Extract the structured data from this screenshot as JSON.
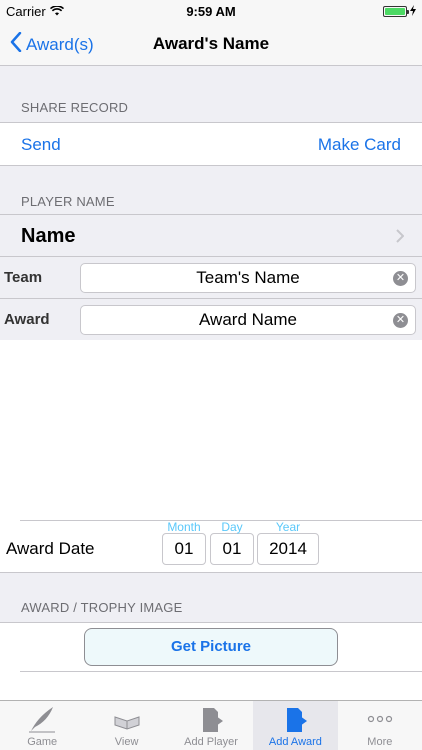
{
  "status": {
    "carrier": "Carrier",
    "time": "9:59 AM",
    "battery_percent": 100
  },
  "nav": {
    "back_label": "Award(s)",
    "title": "Award's Name"
  },
  "share": {
    "header": "SHARE RECORD",
    "send": "Send",
    "make_card": "Make Card"
  },
  "player": {
    "header": "PLAYER NAME",
    "name": "Name"
  },
  "fields": {
    "team_label": "Team",
    "team_value": "Team's Name",
    "award_label": "Award",
    "award_value": "Award Name"
  },
  "date": {
    "label": "Award Date",
    "month_caption": "Month",
    "day_caption": "Day",
    "year_caption": "Year",
    "month": "01",
    "day": "01",
    "year": "2014"
  },
  "image": {
    "header": "AWARD / TROPHY IMAGE",
    "button": "Get Picture"
  },
  "tabs": [
    {
      "label": "Game",
      "icon": "quill-icon",
      "active": false
    },
    {
      "label": "View",
      "icon": "open-book-icon",
      "active": false
    },
    {
      "label": "Add Player",
      "icon": "add-player-icon",
      "active": false
    },
    {
      "label": "Add Award",
      "icon": "add-award-icon",
      "active": true
    },
    {
      "label": "More",
      "icon": "more-dots-icon",
      "active": false
    }
  ],
  "colors": {
    "accent": "#1a73e8",
    "date_caption": "#5ac8fa",
    "battery": "#4cd964"
  }
}
